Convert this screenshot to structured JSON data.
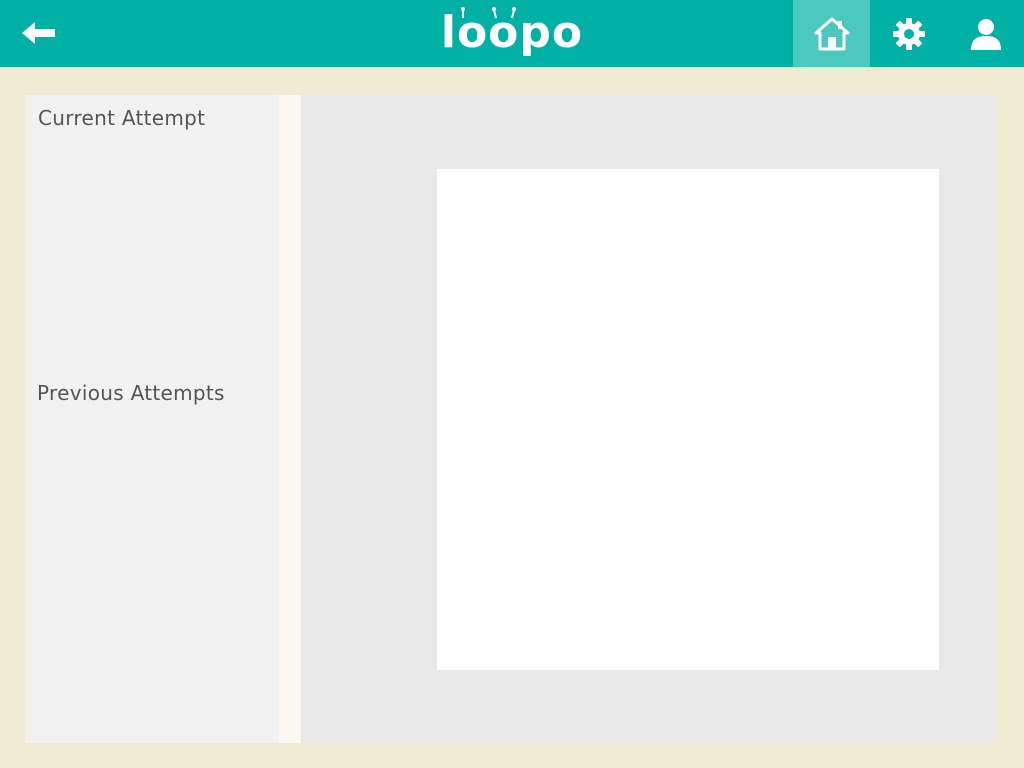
{
  "header": {
    "logo_text": "loopo",
    "colors": {
      "bar": "#00b0a5",
      "active": "#4dc8be"
    },
    "icons": {
      "back": "back-arrow-icon",
      "home": "home-icon",
      "settings": "gear-icon",
      "user": "user-icon"
    }
  },
  "sidebar": {
    "current_label": "Current Attempt",
    "previous_label": "Previous Attempts"
  }
}
